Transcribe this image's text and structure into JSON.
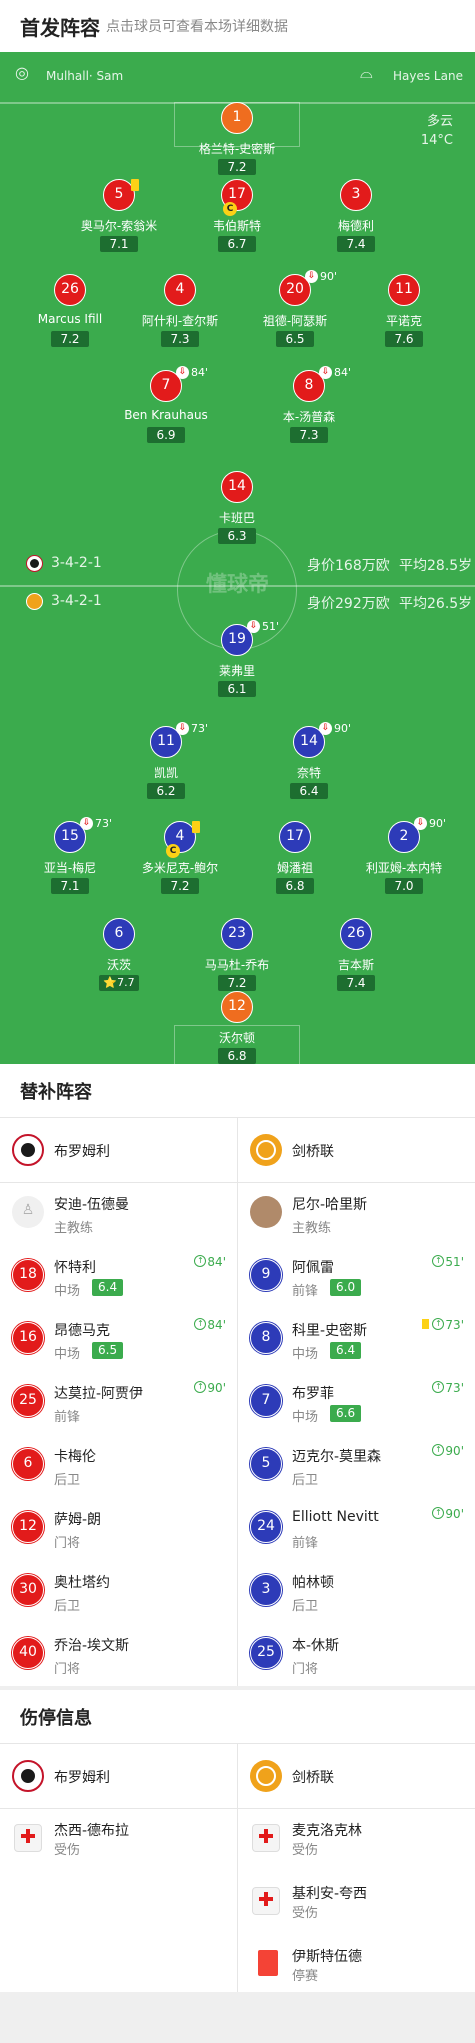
{
  "header": {
    "title": "首发阵容",
    "subtitle": "点击球员可查看本场详细数据"
  },
  "match": {
    "referee": "Mulhall· Sam",
    "venue": "Hayes Lane",
    "weather": "多云",
    "temperature": "14°C",
    "watermark": "懂球帝"
  },
  "home": {
    "formation": "3-4-2-1",
    "value": "身价168万欧",
    "avg_age": "平均28.5岁"
  },
  "away": {
    "formation": "3-4-2-1",
    "value": "身价292万欧",
    "avg_age": "平均26.5岁"
  },
  "home_lineup": [
    {
      "num": "1",
      "name": "格兰特-史密斯",
      "rating": "7.2",
      "color": "orange"
    },
    {
      "num": "5",
      "name": "奥马尔-索翁米",
      "rating": "7.1",
      "color": "red",
      "yellow": true
    },
    {
      "num": "17",
      "name": "韦伯斯特",
      "rating": "6.7",
      "color": "red",
      "captain": "C"
    },
    {
      "num": "3",
      "name": "梅德利",
      "rating": "7.4",
      "color": "red"
    },
    {
      "num": "26",
      "name": "Marcus Ifill",
      "rating": "7.2",
      "color": "red"
    },
    {
      "num": "4",
      "name": "阿什利-查尔斯",
      "rating": "7.3",
      "color": "red"
    },
    {
      "num": "20",
      "name": "祖德-阿瑟斯",
      "rating": "6.5",
      "color": "red",
      "sub": "90'"
    },
    {
      "num": "11",
      "name": "平诺克",
      "rating": "7.6",
      "color": "red"
    },
    {
      "num": "7",
      "name": "Ben Krauhaus",
      "rating": "6.9",
      "color": "red",
      "sub": "84'"
    },
    {
      "num": "8",
      "name": "本-汤普森",
      "rating": "7.3",
      "color": "red",
      "sub": "84'"
    },
    {
      "num": "14",
      "name": "卡班巴",
      "rating": "6.3",
      "color": "red"
    }
  ],
  "away_lineup": [
    {
      "num": "19",
      "name": "莱弗里",
      "rating": "6.1",
      "color": "blue",
      "sub": "51'"
    },
    {
      "num": "11",
      "name": "凯凯",
      "rating": "6.2",
      "color": "blue",
      "sub": "73'"
    },
    {
      "num": "14",
      "name": "奈特",
      "rating": "6.4",
      "color": "blue",
      "sub": "90'"
    },
    {
      "num": "15",
      "name": "亚当-梅尼",
      "rating": "7.1",
      "color": "blue",
      "sub": "73'"
    },
    {
      "num": "4",
      "name": "多米尼克-鲍尔",
      "rating": "7.2",
      "color": "blue",
      "yellow": true,
      "captain": "C"
    },
    {
      "num": "17",
      "name": "姆潘祖",
      "rating": "6.8",
      "color": "blue"
    },
    {
      "num": "2",
      "name": "利亚姆-本内特",
      "rating": "7.0",
      "color": "blue",
      "sub": "90'"
    },
    {
      "num": "6",
      "name": "沃茨",
      "rating": "7.7",
      "color": "blue",
      "star": "⭐"
    },
    {
      "num": "23",
      "name": "马马杜-乔布",
      "rating": "7.2",
      "color": "blue"
    },
    {
      "num": "26",
      "name": "吉本斯",
      "rating": "7.4",
      "color": "blue"
    },
    {
      "num": "12",
      "name": "沃尔顿",
      "rating": "6.8",
      "color": "orange"
    }
  ],
  "subs_section": {
    "title": "替补阵容"
  },
  "teams": {
    "home": "布罗姆利",
    "away": "剑桥联"
  },
  "home_coach": {
    "name": "安迪-伍德曼",
    "role": "主教练"
  },
  "away_coach": {
    "name": "尼尔-哈里斯",
    "role": "主教练"
  },
  "home_subs": [
    {
      "num": "18",
      "name": "怀特利",
      "pos": "中场",
      "rating": "6.4",
      "sub": "84'"
    },
    {
      "num": "16",
      "name": "昂德马克",
      "pos": "中场",
      "rating": "6.5",
      "sub": "84'"
    },
    {
      "num": "25",
      "name": "达莫拉-阿贾伊",
      "pos": "前锋",
      "sub": "90'"
    },
    {
      "num": "6",
      "name": "卡梅伦",
      "pos": "后卫"
    },
    {
      "num": "12",
      "name": "萨姆-朗",
      "pos": "门将"
    },
    {
      "num": "30",
      "name": "奥杜塔约",
      "pos": "后卫"
    },
    {
      "num": "40",
      "name": "乔治-埃文斯",
      "pos": "门将"
    }
  ],
  "away_subs": [
    {
      "num": "9",
      "name": "阿佩雷",
      "pos": "前锋",
      "rating": "6.0",
      "sub": "51'"
    },
    {
      "num": "8",
      "name": "科里-史密斯",
      "pos": "中场",
      "rating": "6.4",
      "sub": "73'",
      "yellow": true
    },
    {
      "num": "7",
      "name": "布罗菲",
      "pos": "中场",
      "rating": "6.6",
      "sub": "73'"
    },
    {
      "num": "5",
      "name": "迈克尔-莫里森",
      "pos": "后卫",
      "sub": "90'"
    },
    {
      "num": "24",
      "name": "Elliott Nevitt",
      "pos": "前锋",
      "sub": "90'"
    },
    {
      "num": "3",
      "name": "帕林顿",
      "pos": "后卫"
    },
    {
      "num": "25",
      "name": "本-休斯",
      "pos": "门将"
    }
  ],
  "injury_section": {
    "title": "伤停信息"
  },
  "home_injuries": [
    {
      "name": "杰西-德布拉",
      "status": "受伤",
      "icon": "medkit-icon"
    }
  ],
  "away_injuries": [
    {
      "name": "麦克洛克林",
      "status": "受伤",
      "icon": "medkit-icon"
    },
    {
      "name": "基利安-夸西",
      "status": "受伤",
      "icon": "medkit-icon"
    },
    {
      "name": "伊斯特伍德",
      "status": "停赛",
      "icon": "red-card-icon"
    }
  ]
}
